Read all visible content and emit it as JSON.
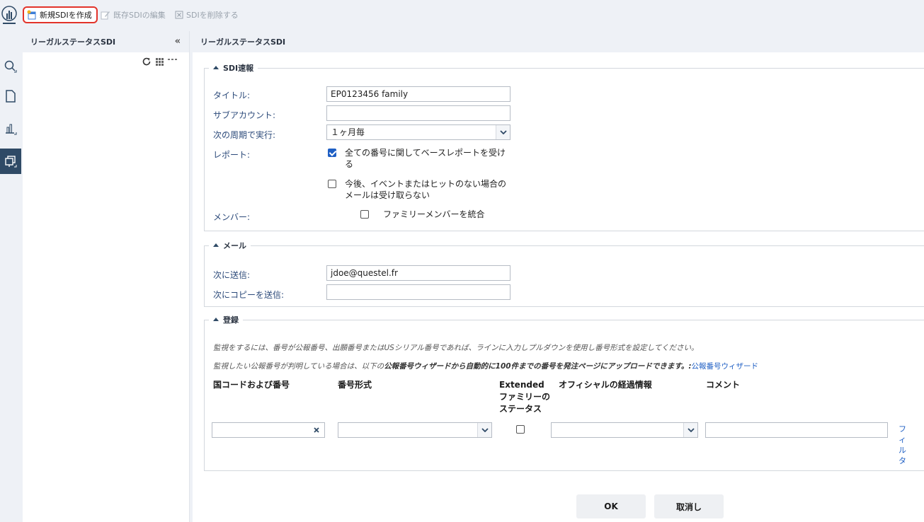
{
  "toolbar": {
    "new_label": "新規SDIを作成",
    "edit_label": "既存SDIの編集",
    "delete_label": "SDIを削除する"
  },
  "left_panel": {
    "title": "リーガルステータスSDI",
    "collapse_glyph": "«"
  },
  "main": {
    "title": "リーガルステータスSDI"
  },
  "sdi_section": {
    "legend": "SDI速報",
    "title_label": "タイトル:",
    "title_value": "EP0123456 family",
    "subaccount_label": "サブアカウント:",
    "subaccount_value": "",
    "period_label": "次の周期で実行:",
    "period_value": "１ヶ月毎",
    "report_label": "レポート:",
    "report_opt1": "全ての番号に関してベースレポートを受け",
    "report_opt1_cont": "る",
    "report_opt1_checked": true,
    "report_opt2": "今後、イベントまたはヒットのない場合の",
    "report_opt2_cont": "メールは受け取らない",
    "report_opt2_checked": false,
    "member_label": "メンバー:",
    "member_opt": "ファミリーメンバーを統合",
    "member_checked": false
  },
  "mail_section": {
    "legend": "メール",
    "to_label": "次に送信:",
    "to_value": "jdoe@questel.fr",
    "cc_label": "次にコピーを送信:",
    "cc_value": ""
  },
  "register_section": {
    "legend": "登録",
    "note1": "監視をするには、番号が公報番号、出願番号またはUSシリアル番号であれば、ラインに入力しプルダウンを使用し番号形式を設定してください。",
    "note2_pre": "監視したい公報番号が判明している場合は、以下の",
    "note2_bold": "公報番号ウィザードから自動的に100件までの番号を発注ページにアップロードできます。:",
    "note2_link": "公報番号ウィザード",
    "col_country": "国コードおよび番号",
    "col_format": "番号形式",
    "col_extended": [
      "Extended",
      "ファミリーの",
      "ステータス"
    ],
    "col_official": "オフィシャルの経過情報",
    "col_comment": "コメント",
    "row_country_value": "",
    "row_format_value": "",
    "row_official_value": "",
    "row_comment_value": "",
    "row_extended_checked": false,
    "filter_link": [
      "フ",
      "ィ",
      "ル",
      "タ"
    ]
  },
  "buttons": {
    "ok": "OK",
    "cancel": "取消し"
  },
  "colors": {
    "accent": "#1f5fc4",
    "highlight": "#e2332a",
    "panel_bg": "#eef1f6",
    "rail_active": "#2f4a66"
  }
}
